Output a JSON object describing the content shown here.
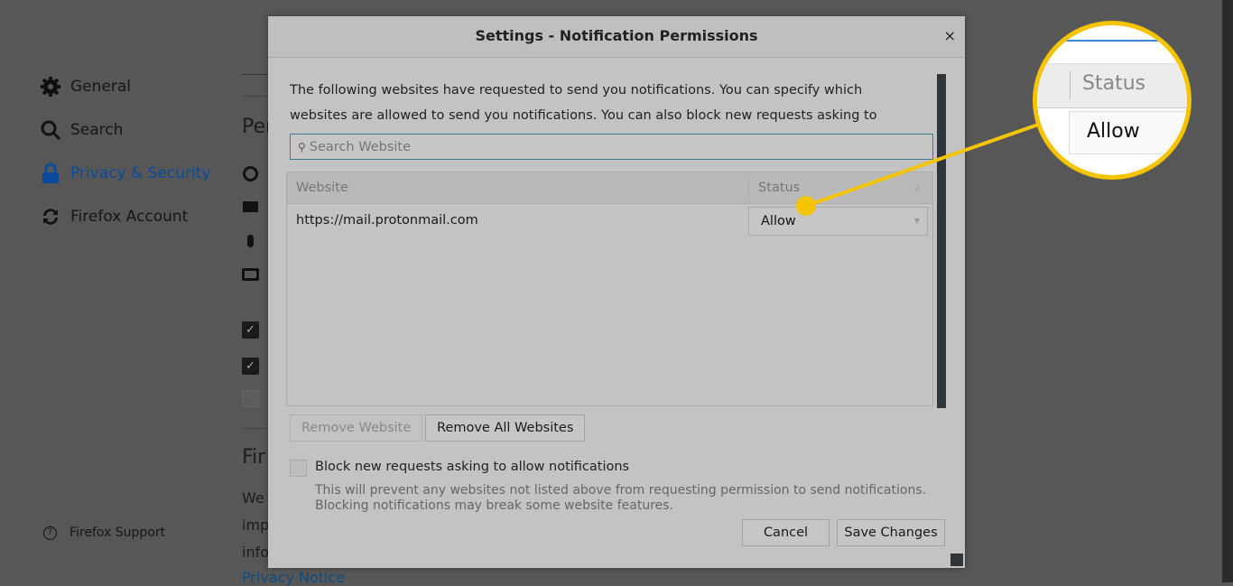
{
  "sidebar": {
    "items": [
      {
        "label": "General",
        "icon": "gear-icon"
      },
      {
        "label": "Search",
        "icon": "search-icon"
      },
      {
        "label": "Privacy & Security",
        "icon": "lock-icon",
        "active": true
      },
      {
        "label": "Firefox Account",
        "icon": "sync-icon"
      }
    ],
    "support": "Firefox Support",
    "active_color": "#0a4a9a"
  },
  "background": {
    "heading1": "Per",
    "heading2": "Fir",
    "line1": "We",
    "line2": "impr",
    "line3": "info",
    "link": "Privacy Notice"
  },
  "dialog": {
    "title": "Settings - Notification Permissions",
    "close": "×",
    "description": "The following websites have requested to send you notifications. You can specify which websites are allowed to send you notifications. You can also block new requests asking to allow notifications.",
    "search_placeholder": "Search Website",
    "columns": [
      "Website",
      "Status"
    ],
    "rows": [
      {
        "website": "https://mail.protonmail.com",
        "status": "Allow"
      }
    ],
    "remove_website": "Remove Website",
    "remove_all": "Remove All Websites",
    "block_label": "Block new requests asking to allow notifications",
    "block_checked": false,
    "block_help1": "This will prevent any websites not listed above from requesting permission to send notifications.",
    "block_help2": "Blocking notifications may break some website features.",
    "cancel": "Cancel",
    "save": "Save Changes"
  },
  "callout": {
    "status": "Status",
    "value": "Allow",
    "color": "#f5c400"
  }
}
